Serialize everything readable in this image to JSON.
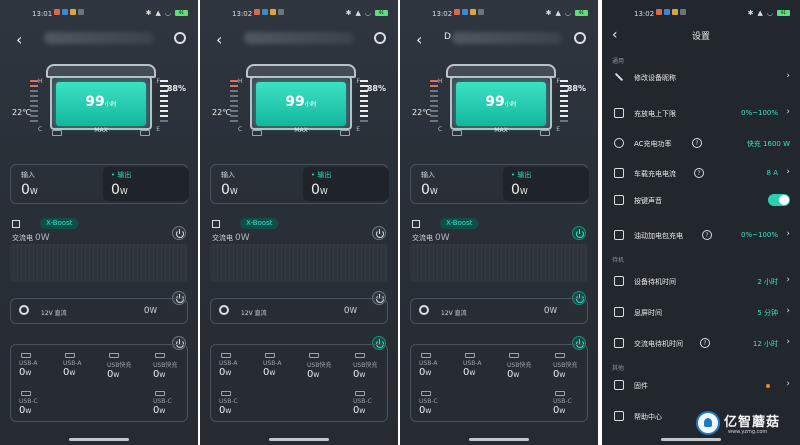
{
  "colors": {
    "accent": "#3fe0c5",
    "bg": "#2a3038",
    "orange": "#f08a24"
  },
  "status": {
    "times": [
      "13:01",
      "13:02",
      "13:02",
      "13:02"
    ],
    "battery": "91"
  },
  "device": {
    "percent": "99",
    "unit": "小时",
    "max_label": "MAX",
    "temp": "22℃",
    "level": "88%",
    "letters": {
      "h": "H",
      "c": "C",
      "f": "F",
      "e": "E"
    }
  },
  "io": {
    "input_label": "输入",
    "output_label": "• 输出",
    "value": "0",
    "unit": "W"
  },
  "ac": {
    "badge": "X-Boost",
    "label": "交流电",
    "value": "0W"
  },
  "dc": {
    "label": "12V 直流",
    "value": "0",
    "unit": "W"
  },
  "usb": [
    {
      "name": "USB-A",
      "value": "0",
      "unit": "W"
    },
    {
      "name": "USB-A",
      "value": "0",
      "unit": "W"
    },
    {
      "name": "USB快充",
      "value": "0",
      "unit": "W"
    },
    {
      "name": "USB快充",
      "value": "0",
      "unit": "W"
    },
    {
      "name": "USB-C",
      "value": "0",
      "unit": "W"
    },
    {
      "name": "USB-C",
      "value": "0",
      "unit": "W"
    }
  ],
  "panel3_title_initial": "D",
  "settings": {
    "title": "设置",
    "section_general": "通用",
    "section_standby": "待机",
    "section_other": "其他",
    "rows": {
      "rename": {
        "label": "修改设备昵称"
      },
      "charge_limit": {
        "label": "充放电上下限",
        "value": "0%~100%"
      },
      "ac_power": {
        "label": "AC充电功率",
        "value": "快充 1600 W"
      },
      "car_current": {
        "label": "车载充电电流",
        "value": "8 A"
      },
      "key_sound": {
        "label": "按键声音"
      },
      "fuel_pack": {
        "label": "油动加电包充电",
        "value": "0%~100%"
      },
      "device_standby": {
        "label": "设备待机时间",
        "value": "2 小时"
      },
      "screen_off": {
        "label": "息屏时间",
        "value": "5 分钟"
      },
      "ac_standby": {
        "label": "交流电待机时间",
        "value": "12 小时"
      },
      "firmware": {
        "label": "固件"
      },
      "help": {
        "label": "帮助中心"
      }
    }
  },
  "watermark": {
    "name": "亿智蘑菇",
    "url": "www.yzmg.com"
  }
}
